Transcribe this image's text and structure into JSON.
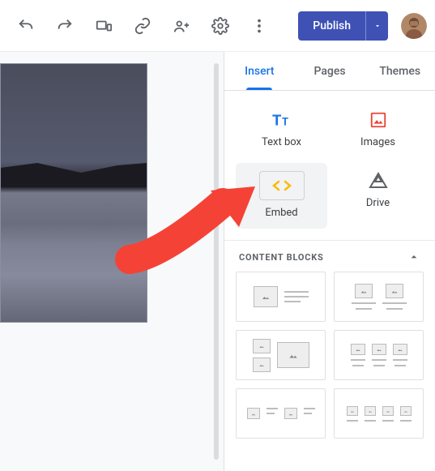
{
  "toolbar": {
    "publish_label": "Publish"
  },
  "panel": {
    "tabs": [
      "Insert",
      "Pages",
      "Themes"
    ],
    "insert": {
      "textbox": "Text box",
      "images": "Images",
      "embed": "Embed",
      "drive": "Drive"
    },
    "section_blocks": "CONTENT BLOCKS"
  }
}
